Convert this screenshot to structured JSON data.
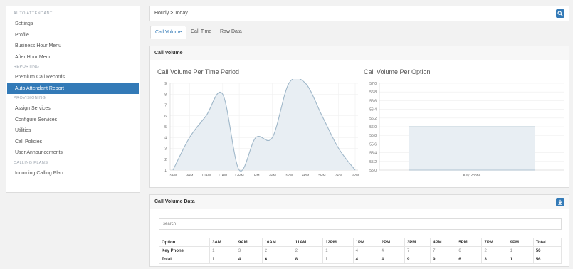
{
  "sidebar": {
    "sections": [
      {
        "title": "AUTO ATTENDANT",
        "items": [
          "Settings",
          "Profile",
          "Business Hour Menu",
          "After Hour Menu"
        ]
      },
      {
        "title": "REPORTING",
        "items": [
          "Premium Call Records",
          "Auto Attendant Report"
        ]
      },
      {
        "title": "PROVISIONING",
        "items": [
          "Assign Services",
          "Configure Services",
          "Utilities",
          "Call Policies",
          "User Announcements"
        ]
      },
      {
        "title": "CALLING PLANS",
        "items": [
          "Incoming Calling Plan"
        ]
      }
    ],
    "active_item": "Auto Attendant Report"
  },
  "header": {
    "breadcrumb": "Hourly > Today",
    "search_icon": "search-icon"
  },
  "tabs": [
    "Call Volume",
    "Call Time",
    "Raw Data"
  ],
  "active_tab": "Call Volume",
  "call_volume_panel": {
    "title": "Call Volume"
  },
  "chart_data": [
    {
      "type": "area",
      "title": "Call Volume Per Time Period",
      "x": [
        "3AM",
        "9AM",
        "10AM",
        "11AM",
        "12PM",
        "1PM",
        "2PM",
        "3PM",
        "4PM",
        "5PM",
        "7PM",
        "9PM"
      ],
      "values": [
        1,
        4,
        6,
        8,
        1,
        4,
        4,
        9,
        9,
        6,
        3,
        1
      ],
      "ylim": [
        1,
        9
      ],
      "yticks": [
        1,
        2,
        3,
        4,
        5,
        6,
        7,
        8,
        9
      ],
      "grid": true,
      "fill_color": "#e8eef3",
      "line_color": "#9fb7c9"
    },
    {
      "type": "bar",
      "title": "Call Volume Per Option",
      "categories": [
        "Key Phone"
      ],
      "values": [
        56
      ],
      "ylim": [
        55.0,
        57.0
      ],
      "yticks": [
        "55.0",
        "55.2",
        "55.4",
        "55.6",
        "55.8",
        "56.0",
        "56.2",
        "56.4",
        "56.6",
        "56.8",
        "57.0"
      ],
      "grid": true,
      "bar_color": "#e8eef3",
      "line_color": "#9fb7c9"
    }
  ],
  "call_volume_data": {
    "title": "Call Volume Data",
    "search_placeholder": "search",
    "columns": [
      "Option",
      "3AM",
      "9AM",
      "10AM",
      "11AM",
      "12PM",
      "1PM",
      "2PM",
      "3PM",
      "4PM",
      "5PM",
      "7PM",
      "9PM",
      "Total"
    ],
    "rows": [
      [
        "Key Phone",
        "1",
        "3",
        "2",
        "2",
        "1",
        "4",
        "4",
        "7",
        "7",
        "6",
        "2",
        "1",
        "56"
      ],
      [
        "Total",
        "1",
        "4",
        "6",
        "8",
        "1",
        "4",
        "4",
        "9",
        "9",
        "6",
        "3",
        "1",
        "56"
      ]
    ]
  },
  "colors": {
    "accent": "#337ab7"
  }
}
